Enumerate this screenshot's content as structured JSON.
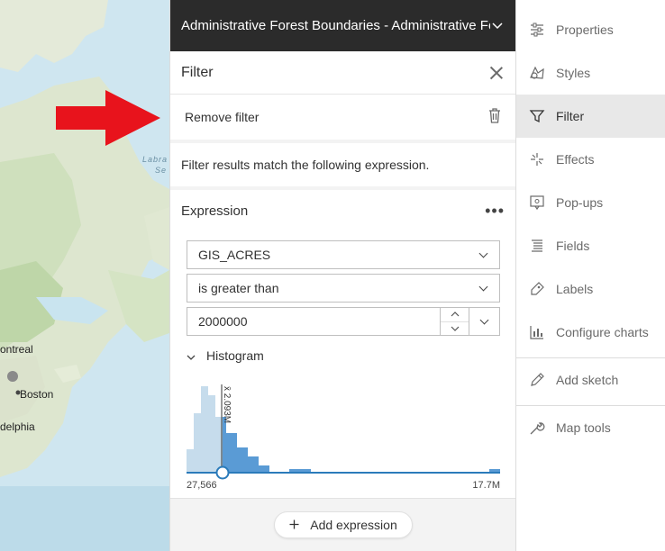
{
  "map": {
    "labels": {
      "montreal": "ontreal",
      "boston": "Boston",
      "philadelphia": "delphia",
      "labrador_sea_1": "Labra",
      "labrador_sea_2": "Se"
    }
  },
  "panel": {
    "layer_title": "Administrative Forest Boundaries - Administrative Forest Boundaries",
    "filter_title": "Filter",
    "remove_filter_label": "Remove filter",
    "description": "Filter results match the following expression.",
    "expression": {
      "title": "Expression",
      "field": "GIS_ACRES",
      "operator": "is greater than",
      "value": "2000000",
      "histogram_label": "Histogram",
      "histogram_min": "27,566",
      "histogram_max": "17.7M",
      "mean_label": "x̄ 2.093M"
    },
    "add_expression_label": "Add expression"
  },
  "sidebar": {
    "items": [
      {
        "label": "Properties",
        "icon": "properties-icon"
      },
      {
        "label": "Styles",
        "icon": "styles-icon"
      },
      {
        "label": "Filter",
        "icon": "filter-icon"
      },
      {
        "label": "Effects",
        "icon": "effects-icon"
      },
      {
        "label": "Pop-ups",
        "icon": "popups-icon"
      },
      {
        "label": "Fields",
        "icon": "fields-icon"
      },
      {
        "label": "Labels",
        "icon": "labels-icon"
      },
      {
        "label": "Configure charts",
        "icon": "charts-icon"
      },
      {
        "label": "Add sketch",
        "icon": "sketch-icon"
      },
      {
        "label": "Map tools",
        "icon": "wrench-icon"
      }
    ]
  },
  "colors": {
    "accent": "#2b7bba",
    "arrow": "#e8131c",
    "header_bg": "#2b2b2b",
    "hist_bar": "#5a9bd5",
    "hist_bar_light": "#c6dcec"
  }
}
